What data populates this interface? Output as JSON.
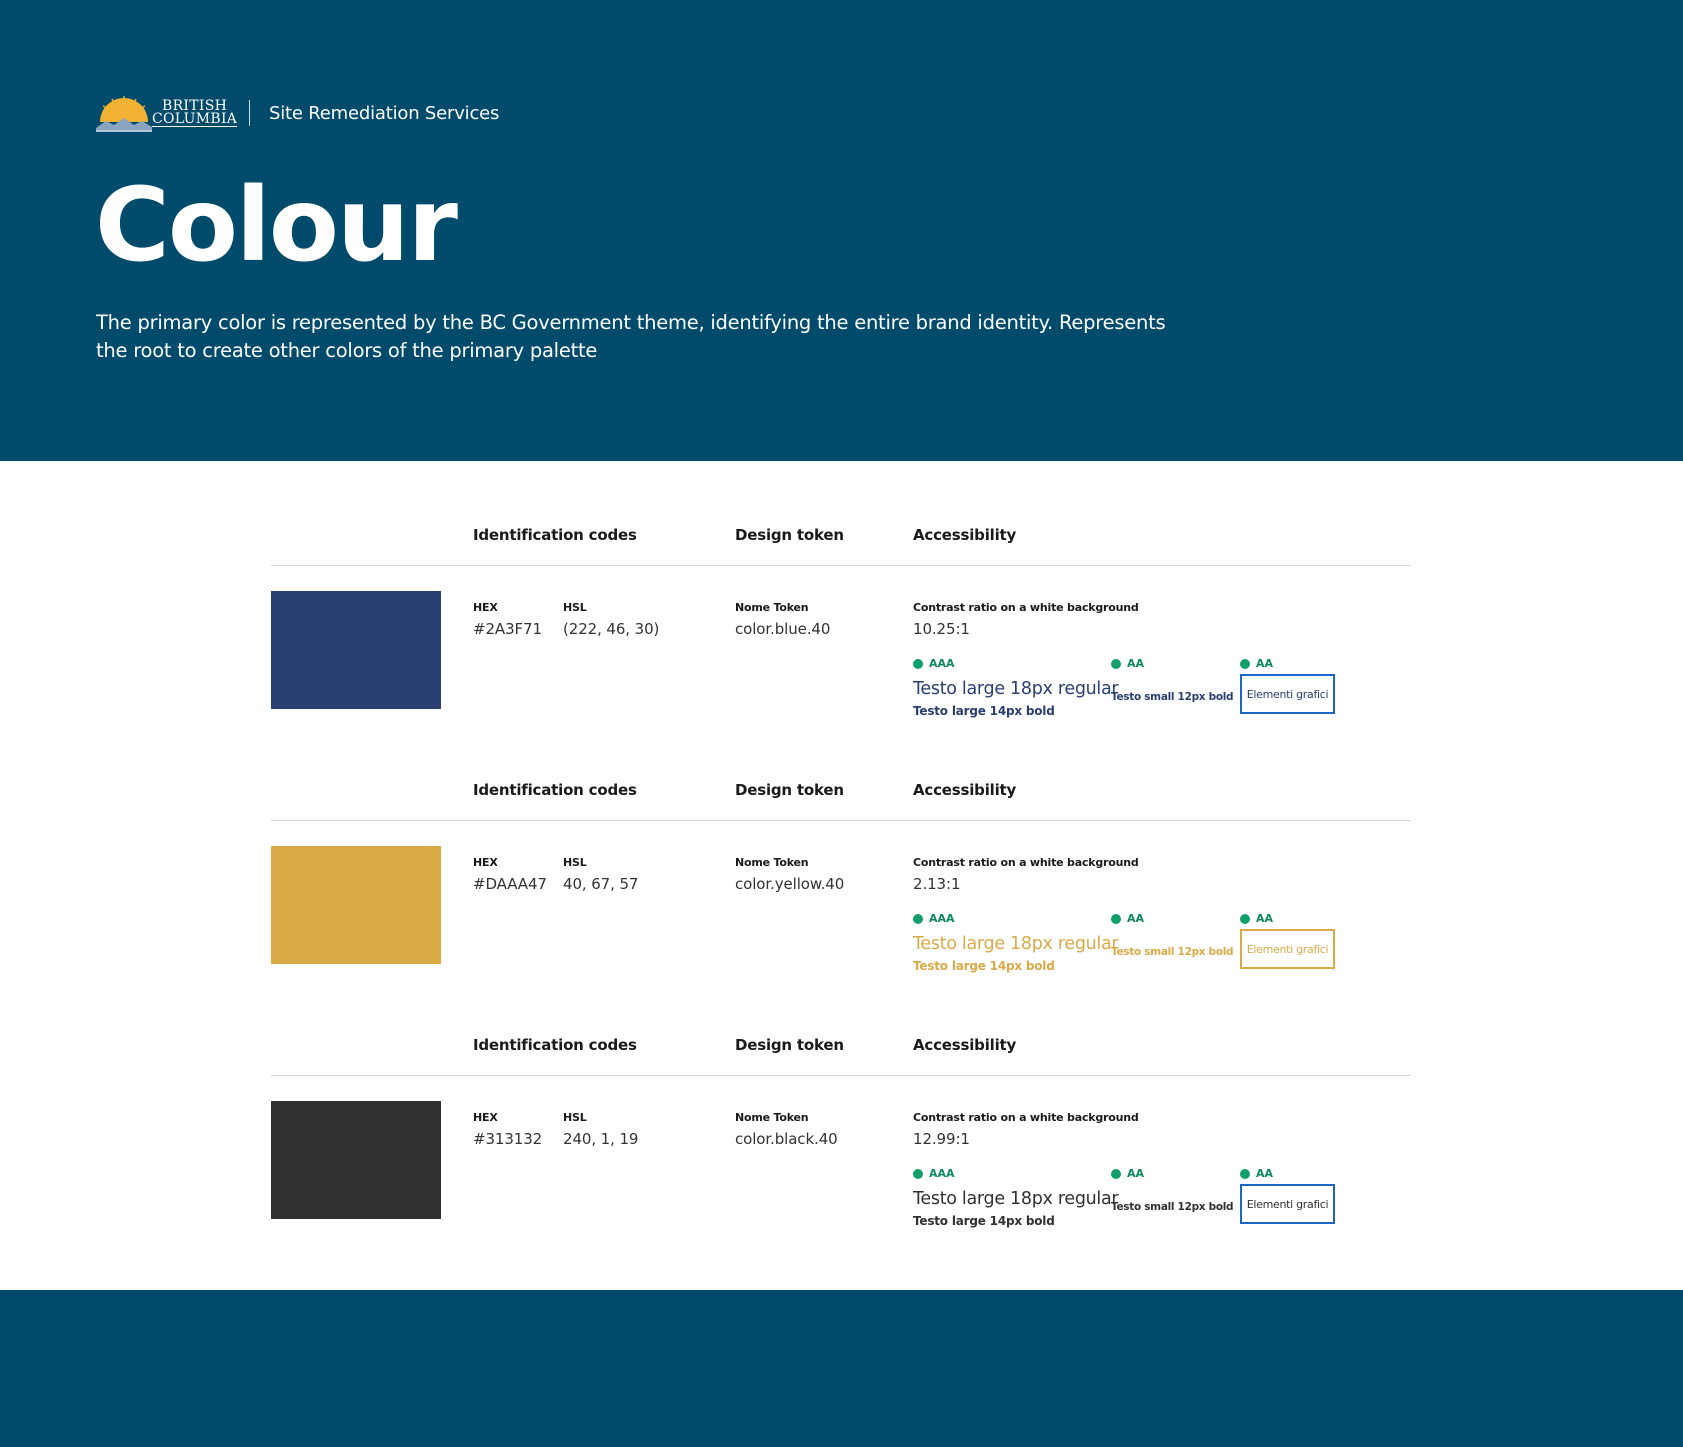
{
  "header": {
    "logo_line1": "BRITISH",
    "logo_line2": "COLUMBIA",
    "site_name": "Site Remediation Services",
    "title": "Colour",
    "intro": "The primary color is represented by the BC Government theme, identifying the entire brand identity. Represents the root to create other colors of the primary palette"
  },
  "labels": {
    "identification_codes": "Identification codes",
    "design_token": "Design token",
    "accessibility": "Accessibility",
    "hex": "HEX",
    "hsl": "HSL",
    "token_name": "Nome Token",
    "contrast": "Contrast ratio on a white background",
    "level_aaa": "AAA",
    "level_aa": "AA",
    "text_large_regular": "Testo large 18px regular",
    "text_large_bold": "Testo large 14px bold",
    "text_small_bold": "Testo small 12px bold",
    "graphic_elements": "Elementi grafici"
  },
  "colors": [
    {
      "hex": "#2A3F71",
      "hsl": "(222, 46, 30)",
      "token": "color.blue.40",
      "contrast": "10.25:1",
      "swatch": "#2A3F71",
      "text_color": "#2A3F71",
      "box_border": "#1a66c9"
    },
    {
      "hex": "#DAAA47",
      "hsl": "40, 67, 57",
      "token": "color.yellow.40",
      "contrast": "2.13:1",
      "swatch": "#DAAA47",
      "text_color": "#DAAA47",
      "box_border": "#DAAA47"
    },
    {
      "hex": "#313132",
      "hsl": "240, 1, 19",
      "token": "color.black.40",
      "contrast": "12.99:1",
      "swatch": "#313132",
      "text_color": "#313132",
      "box_border": "#1a66c9"
    }
  ],
  "theme": {
    "hero_background": "#004B6B",
    "badge_green": "#11a06a"
  }
}
